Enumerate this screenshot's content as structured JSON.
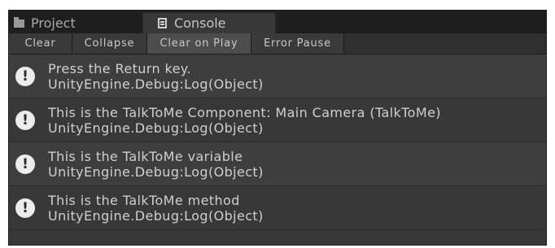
{
  "tabs": {
    "project": {
      "label": "Project",
      "icon": "folder-icon"
    },
    "console": {
      "label": "Console",
      "icon": "console-icon"
    }
  },
  "toolbar": {
    "clear": "Clear",
    "collapse": "Collapse",
    "clear_on_play": "Clear on Play",
    "error_pause": "Error Pause",
    "active": "Clear on Play"
  },
  "logs": [
    {
      "message": "Press the Return key.",
      "stack": "UnityEngine.Debug:Log(Object)",
      "icon": "info-icon"
    },
    {
      "message": "This is the TalkToMe Component: Main Camera (TalkToMe)",
      "stack": "UnityEngine.Debug:Log(Object)",
      "icon": "info-icon"
    },
    {
      "message": "This is the TalkToMe variable",
      "stack": "UnityEngine.Debug:Log(Object)",
      "icon": "info-icon"
    },
    {
      "message": "This is the TalkToMe method",
      "stack": "UnityEngine.Debug:Log(Object)",
      "icon": "info-icon"
    }
  ],
  "colors": {
    "panel": "#383838",
    "tab_strip": "#1f1f1f",
    "toolbar": "#2f2f2f",
    "text": "#cfcfcf"
  }
}
